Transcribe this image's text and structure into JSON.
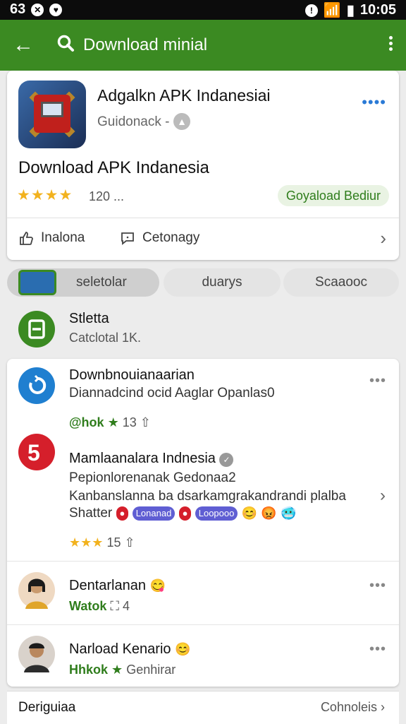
{
  "status_bar": {
    "time_left": "63",
    "time_right": "10:05"
  },
  "app_bar": {
    "title": "Download minial"
  },
  "app_card": {
    "name": "Adgalkn APK Indanesiai",
    "developer": "Guidonack -",
    "headline": "Download APK Indanesia",
    "stars": "★★★★",
    "rating_count": "120 ...",
    "chip_label": "Goyaload Bediur",
    "action_1": "Inalona",
    "action_2": "Cetonagy",
    "colors": {
      "accent": "#3b8a22",
      "link": "#2a7ad6"
    }
  },
  "tabs": [
    {
      "label": "seletolar"
    },
    {
      "label": "duarys"
    },
    {
      "label": "Scaaooc"
    }
  ],
  "section": {
    "title": "Stletta",
    "subtitle": "Catclotal 1K."
  },
  "list": {
    "items": [
      {
        "name": "Downbnouianaarian",
        "desc": "Diannadcind ocid Aaglar Opanlas0",
        "tag": "@hok",
        "rating": "★",
        "count": "13"
      },
      {
        "name": "Mamlaanalara Indnesia",
        "desc": "Pepionlorenanak Gedonaa2",
        "desc2": "Kanbanslanna ba dsarkamgrakandrandi plalba",
        "desc3": "Shatter",
        "pill1": "Lonanad",
        "pill2": "Loopooo",
        "rating": "★★★",
        "count": "15"
      },
      {
        "name": "Dentarlanan",
        "tag": "Watok",
        "count": "4"
      },
      {
        "name": "Narload Kenario",
        "tag": "Hhkok",
        "rating": "★",
        "meta": "Genhirar"
      }
    ]
  },
  "bottom_bar": {
    "left": "Deriguiaa",
    "right": "Cohnoleis"
  }
}
